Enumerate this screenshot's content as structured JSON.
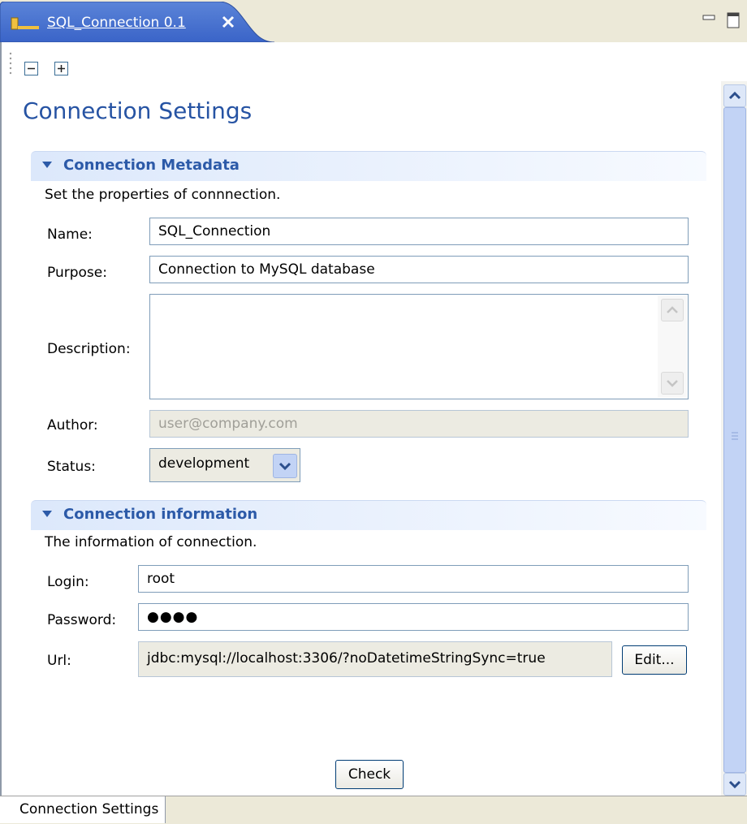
{
  "tab": {
    "title": "SQL_Connection 0.1"
  },
  "page": {
    "title": "Connection Settings"
  },
  "metadata": {
    "header": "Connection Metadata",
    "description": "Set the properties of connnection.",
    "name_label": "Name:",
    "name_value": "SQL_Connection",
    "purpose_label": "Purpose:",
    "purpose_value": "Connection to MySQL database",
    "description_label": "Description:",
    "description_value": "",
    "author_label": "Author:",
    "author_value": "user@company.com",
    "status_label": "Status:",
    "status_value": "development"
  },
  "connection": {
    "header": "Connection information",
    "description": "The information of connection.",
    "login_label": "Login:",
    "login_value": "root",
    "password_label": "Password:",
    "password_value": "●●●●",
    "url_label": "Url:",
    "url_value": "jdbc:mysql://localhost:3306/?noDatetimeStringSync=true",
    "edit_label": "Edit...",
    "check_label": "Check"
  },
  "bottom_tab": {
    "label": "Connection Settings"
  },
  "icons": [
    "connection-icon",
    "close-icon",
    "minimize-icon",
    "maximize-icon",
    "collapse-all-icon",
    "expand-all-icon",
    "scroll-up-icon",
    "scroll-down-icon",
    "dropdown-arrow-icon"
  ],
  "colors": {
    "accent": "#2653a3",
    "tab_active": "#3a64c8",
    "section_header": "#dce8fb"
  }
}
